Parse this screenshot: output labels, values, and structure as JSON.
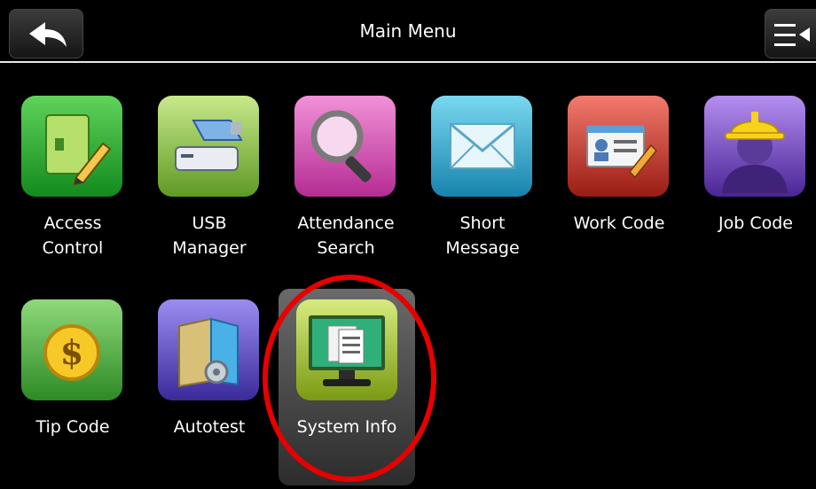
{
  "header": {
    "title": "Main Menu",
    "back_icon": "back-arrow-icon",
    "menu_icon": "menu-options-icon"
  },
  "tiles": [
    {
      "label": "Access\nControl",
      "icon": "access-control-icon",
      "color": "#28a72e"
    },
    {
      "label": "USB\nManager",
      "icon": "usb-drive-icon",
      "color": "#8cc63f"
    },
    {
      "label": "Attendance\nSearch",
      "icon": "magnifier-icon",
      "color": "#d845b5"
    },
    {
      "label": "Short\nMessage",
      "icon": "envelope-icon",
      "color": "#2cb7d8"
    },
    {
      "label": "Work Code",
      "icon": "id-card-icon",
      "color": "#c9322a"
    },
    {
      "label": "Job Code",
      "icon": "hard-hat-worker-icon",
      "color": "#7a4cc9"
    },
    {
      "label": "Tip Code",
      "icon": "dollar-coin-icon",
      "color": "#4fae45"
    },
    {
      "label": "Autotest",
      "icon": "autotest-folder-icon",
      "color": "#5b49c9"
    },
    {
      "label": "System Info",
      "icon": "monitor-document-icon",
      "color": "#9bbf2a",
      "selected": true
    }
  ],
  "highlight_color": "#e60000"
}
